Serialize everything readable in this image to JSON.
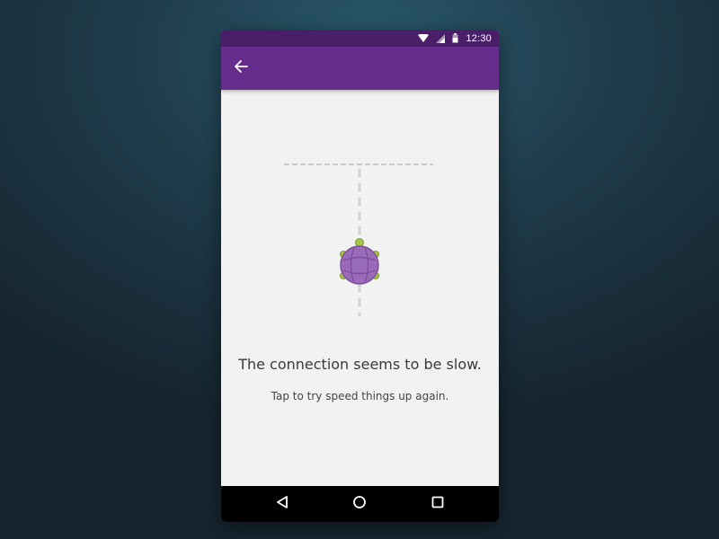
{
  "status_bar": {
    "time": "12:30",
    "icons": [
      "wifi-icon",
      "signal-icon",
      "battery-icon"
    ]
  },
  "app_bar": {
    "back_icon": "arrow-left-icon"
  },
  "empty_state": {
    "illustration": "turtle-icon",
    "headline": "The connection seems to be slow.",
    "subline": "Tap to try speed things up again."
  },
  "nav_bar": {
    "icons": [
      "back-triangle-icon",
      "home-circle-icon",
      "recents-square-icon"
    ]
  },
  "colors": {
    "status_bar": "#4a1f68",
    "app_bar": "#662d8c",
    "content_bg": "#f2f2f3",
    "turtle_shell": "#9a6bb8",
    "turtle_limbs": "#a7c44a",
    "dashed_line": "#c8c8d0"
  }
}
